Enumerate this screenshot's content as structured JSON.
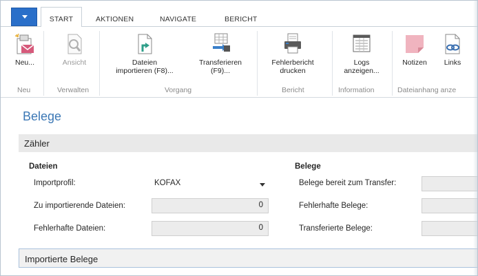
{
  "tabs": [
    {
      "label": "START",
      "active": true
    },
    {
      "label": "AKTIONEN"
    },
    {
      "label": "NAVIGATE"
    },
    {
      "label": "BERICHT"
    }
  ],
  "ribbon": {
    "buttons": {
      "neu": "Neu...",
      "ansicht": "Ansicht",
      "dateien_importieren": [
        "Dateien",
        "importieren (F8)..."
      ],
      "transferieren": [
        "Transferieren",
        "(F9)..."
      ],
      "fehlerbericht": [
        "Fehlerbericht",
        "drucken"
      ],
      "logs": [
        "Logs",
        "anzeigen..."
      ],
      "notizen": "Notizen",
      "links": "Links"
    },
    "groups": {
      "neu": "Neu",
      "verwalten": "Verwalten",
      "vorgang": "Vorgang",
      "bericht": "Bericht",
      "information": "Information",
      "dateianhang": "Dateianhang anze"
    }
  },
  "page": {
    "title": "Belege",
    "section_counter": "Zähler",
    "section_imported": "Importierte Belege"
  },
  "dateien": {
    "header": "Dateien",
    "importprofil_label": "Importprofil:",
    "importprofil_value": "KOFAX",
    "zu_importierende_label": "Zu importierende Dateien:",
    "zu_importierende_value": "0",
    "fehlerhafte_label": "Fehlerhafte Dateien:",
    "fehlerhafte_value": "0"
  },
  "belege": {
    "header": "Belege",
    "bereit_label": "Belege bereit zum Transfer:",
    "fehlerhafte_label": "Fehlerhafte Belege:",
    "transferierte_label": "Transferierte Belege:"
  },
  "colors": {
    "accent": "#3c78b5",
    "app_button": "#2a6fc9"
  }
}
